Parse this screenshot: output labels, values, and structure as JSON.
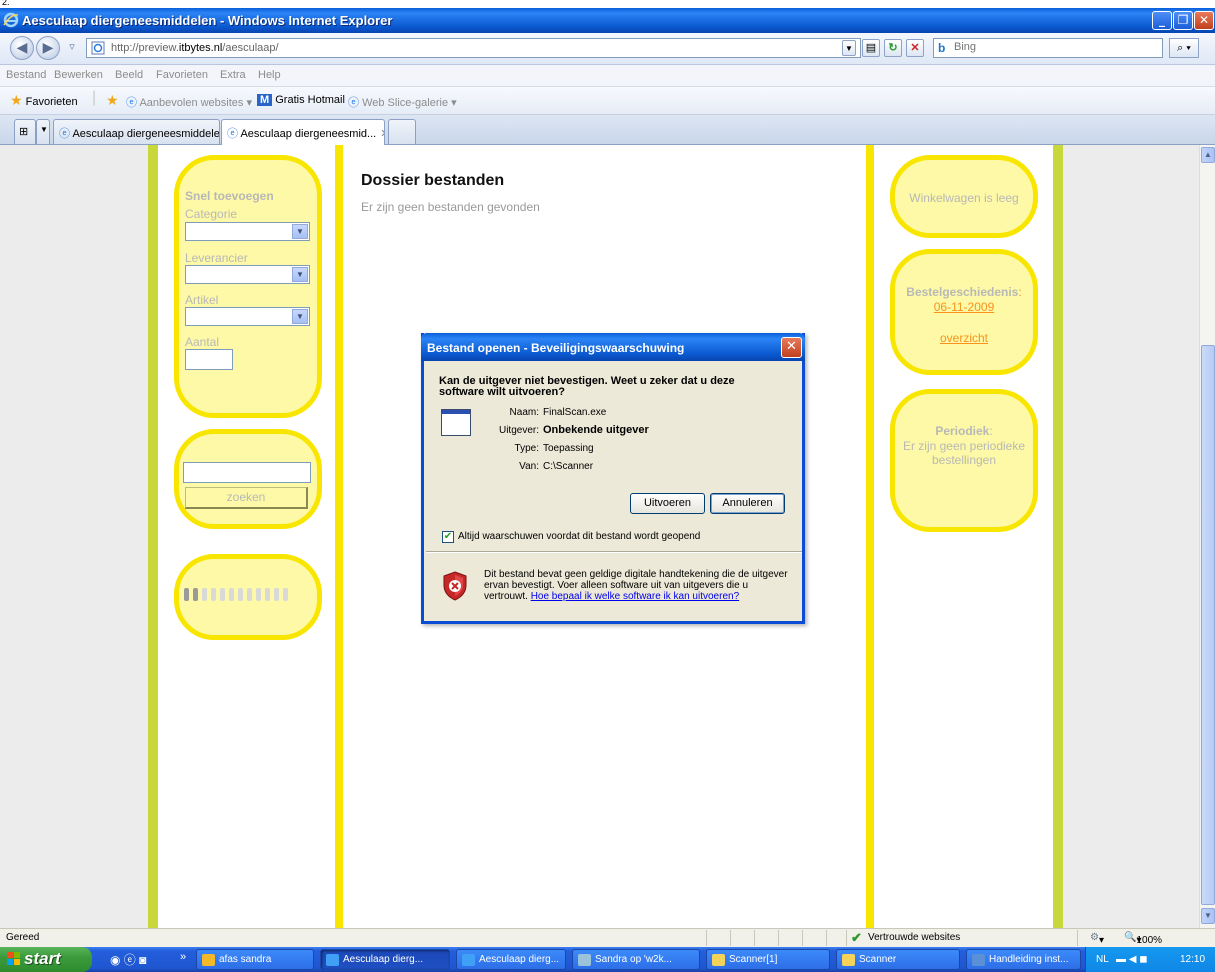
{
  "top_fragment": "2.",
  "window": {
    "title": "Aesculaap diergeneesmiddelen - Windows Internet Explorer",
    "min": "_",
    "max": "❐",
    "close": "✕"
  },
  "address": {
    "url_prefix": "http://preview.",
    "url_domain": "itbytes.nl",
    "url_path": "/aesculaap/",
    "search_placeholder": "Bing"
  },
  "menu": [
    "Bestand",
    "Bewerken",
    "Beeld",
    "Favorieten",
    "Extra",
    "Help"
  ],
  "favorites": {
    "favorites_label": "Favorieten",
    "suggested": "Aanbevolen websites ▾",
    "hotmail": "Gratis Hotmail",
    "webslice": "Web Slice-galerie ▾"
  },
  "tabs": [
    {
      "label": "Aesculaap diergeneesmiddelen"
    },
    {
      "label": "Aesculaap diergeneesmid...",
      "close": "✕"
    }
  ],
  "sidebar": {
    "quick_add_title": "Snel toevoegen",
    "category_label": "Categorie",
    "supplier_label": "Leverancier",
    "article_label": "Artikel",
    "amount_label": "Aantal",
    "search_button": "zoeken",
    "loader_segments": 12,
    "loader_active": 2
  },
  "main": {
    "title": "Dossier bestanden",
    "message": "Er zijn geen bestanden gevonden"
  },
  "right": {
    "cart": "Winkelwagen is leeg",
    "history_title": "Bestelgeschiedenis",
    "history_colon": ":",
    "history_date": "06-11-2009",
    "history_overview": "overzicht",
    "periodic_title": "Periodiek",
    "periodic_colon": ":",
    "periodic_text": "Er zijn geen periodieke bestellingen"
  },
  "dialog": {
    "title": "Bestand openen - Beveiligingswaarschuwing",
    "question": "Kan de uitgever niet bevestigen. Weet u zeker dat u deze software wilt uitvoeren?",
    "fields": [
      {
        "key": "Naam:",
        "value": "FinalScan.exe",
        "bold": false
      },
      {
        "key": "Uitgever:",
        "value": "Onbekende uitgever",
        "bold": true
      },
      {
        "key": "Type:",
        "value": "Toepassing",
        "bold": false
      },
      {
        "key": "Van:",
        "value": "C:\\Scanner",
        "bold": false
      }
    ],
    "run_button": "Uitvoeren",
    "cancel_button": "Annuleren",
    "checkbox_label": "Altijd waarschuwen voordat dit bestand wordt geopend",
    "checkbox_checked": true,
    "warning_text": "Dit bestand bevat geen geldige digitale handtekening die de uitgever ervan bevestigt. Voer alleen software uit van uitgevers die u vertrouwt. ",
    "warning_link": "Hoe bepaal ik welke software ik kan uitvoeren?"
  },
  "status": {
    "text": "Gereed",
    "zone": "Vertrouwde websites",
    "zoom": "100%",
    "zoom_arrow": "▾",
    "protect": "▾"
  },
  "taskbar": {
    "start": "start",
    "overflow": "»",
    "items": [
      {
        "label": "afas sandra",
        "color": "#f3b928"
      },
      {
        "label": "Aesculaap dierg...",
        "color": "#3fa0f5"
      },
      {
        "label": "Aesculaap dierg...",
        "color": "#3fa0f5"
      },
      {
        "label": "Sandra op 'w2k...",
        "color": "#9ac2d8"
      },
      {
        "label": "Scanner[1]",
        "color": "#f5d35b"
      },
      {
        "label": "Scanner",
        "color": "#f5d35b"
      },
      {
        "label": "Handleiding inst...",
        "color": "#5b8fd6"
      }
    ],
    "lang": "NL",
    "time": "12:10"
  },
  "colors": {
    "accent_yellow": "#f8e600",
    "box_fill": "#fdf9a6",
    "strip_green": "#c8d83a",
    "xp_blue": "#0b59d0",
    "link_orange": "#f7931e"
  }
}
